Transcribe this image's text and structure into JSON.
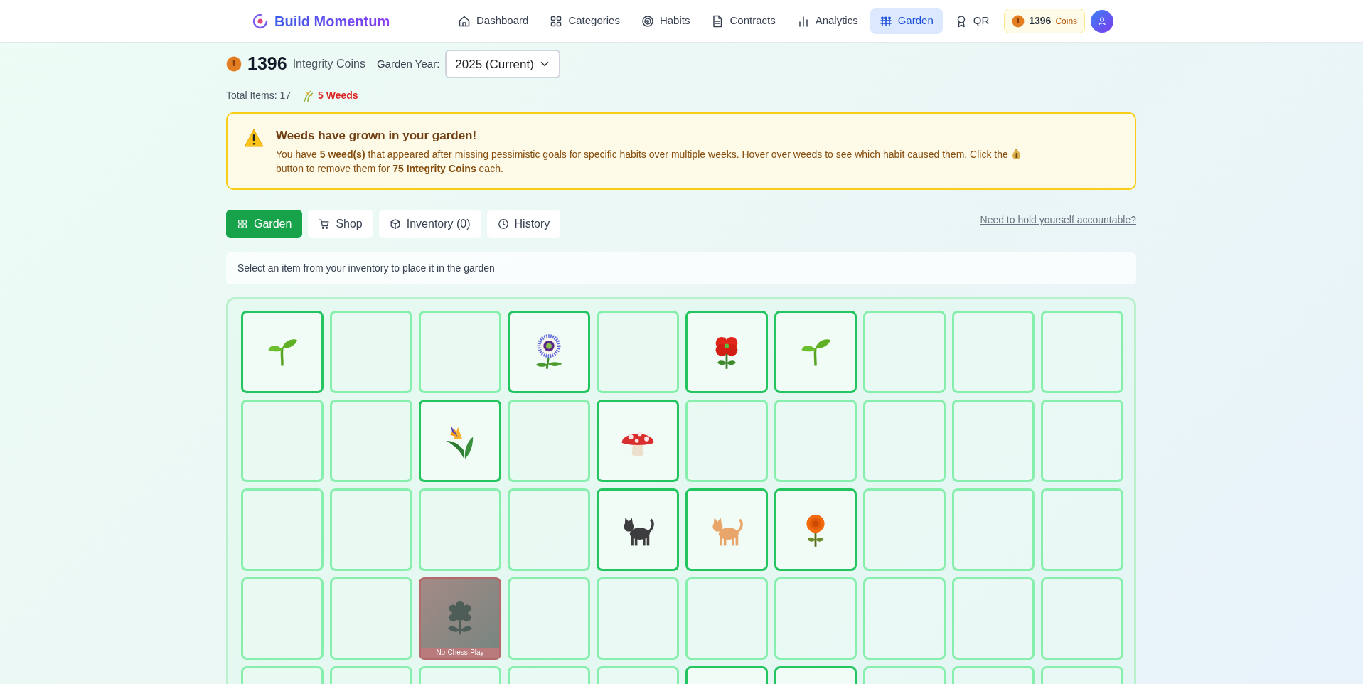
{
  "brand": "Build Momentum",
  "nav": [
    {
      "label": "Dashboard",
      "selected": false
    },
    {
      "label": "Categories",
      "selected": false
    },
    {
      "label": "Habits",
      "selected": false
    },
    {
      "label": "Contracts",
      "selected": false
    },
    {
      "label": "Analytics",
      "selected": false
    },
    {
      "label": "Garden",
      "selected": true
    },
    {
      "label": "QR",
      "selected": false
    }
  ],
  "coins_pill": {
    "amount": "1396",
    "label": "Coins"
  },
  "summary": {
    "amount": "1396",
    "label": "Integrity Coins",
    "year_label": "Garden Year:",
    "year_value": "2025 (Current)",
    "total_items": "Total Items: 17",
    "weeds": "5 Weeds"
  },
  "alert": {
    "title": "Weeds have grown in your garden!",
    "text_before": "You have **5 weed(s)** that appeared after missing pessimistic goals for specific habits over multiple weeks. Hover over weeds to see which habit caused them. Click the",
    "text_after": "button to remove them for **75 Integrity Coins** each."
  },
  "tabs": [
    {
      "label": "Garden",
      "selected": true
    },
    {
      "label": "Shop",
      "selected": false
    },
    {
      "label": "Inventory (0)",
      "selected": false
    },
    {
      "label": "History",
      "selected": false
    }
  ],
  "accountability_link": "Need to hold yourself accountable?",
  "info": "Select an item from your inventory to place it in the garden",
  "garden": {
    "rows": [
      [
        {
          "kind": "sprout"
        },
        {
          "kind": "empty"
        },
        {
          "kind": "empty"
        },
        {
          "kind": "passionflower"
        },
        {
          "kind": "empty"
        },
        {
          "kind": "poppy"
        },
        {
          "kind": "sprout"
        },
        {
          "kind": "empty"
        },
        {
          "kind": "empty"
        },
        {
          "kind": "empty"
        }
      ],
      [
        {
          "kind": "empty"
        },
        {
          "kind": "empty"
        },
        {
          "kind": "bird_of_paradise"
        },
        {
          "kind": "empty"
        },
        {
          "kind": "mushroom"
        },
        {
          "kind": "empty"
        },
        {
          "kind": "empty"
        },
        {
          "kind": "empty"
        },
        {
          "kind": "empty"
        },
        {
          "kind": "empty"
        }
      ],
      [
        {
          "kind": "empty"
        },
        {
          "kind": "empty"
        },
        {
          "kind": "empty"
        },
        {
          "kind": "empty"
        },
        {
          "kind": "cat",
          "color": "#3d3d3f"
        },
        {
          "kind": "cat",
          "color": "#e9a66a"
        },
        {
          "kind": "marigold"
        },
        {
          "kind": "empty"
        },
        {
          "kind": "empty"
        },
        {
          "kind": "empty"
        }
      ],
      [
        {
          "kind": "empty"
        },
        {
          "kind": "empty"
        },
        {
          "kind": "weed",
          "habit": "No-Chess-Play"
        },
        {
          "kind": "empty"
        },
        {
          "kind": "empty"
        },
        {
          "kind": "empty"
        },
        {
          "kind": "empty"
        },
        {
          "kind": "empty"
        },
        {
          "kind": "empty"
        },
        {
          "kind": "empty"
        }
      ],
      [
        {
          "kind": "empty"
        },
        {
          "kind": "empty"
        },
        {
          "kind": "empty"
        },
        {
          "kind": "empty"
        },
        {
          "kind": "empty"
        },
        {
          "kind": "occupied"
        },
        {
          "kind": "occupied"
        },
        {
          "kind": "empty"
        },
        {
          "kind": "empty"
        },
        {
          "kind": "empty"
        }
      ]
    ]
  }
}
